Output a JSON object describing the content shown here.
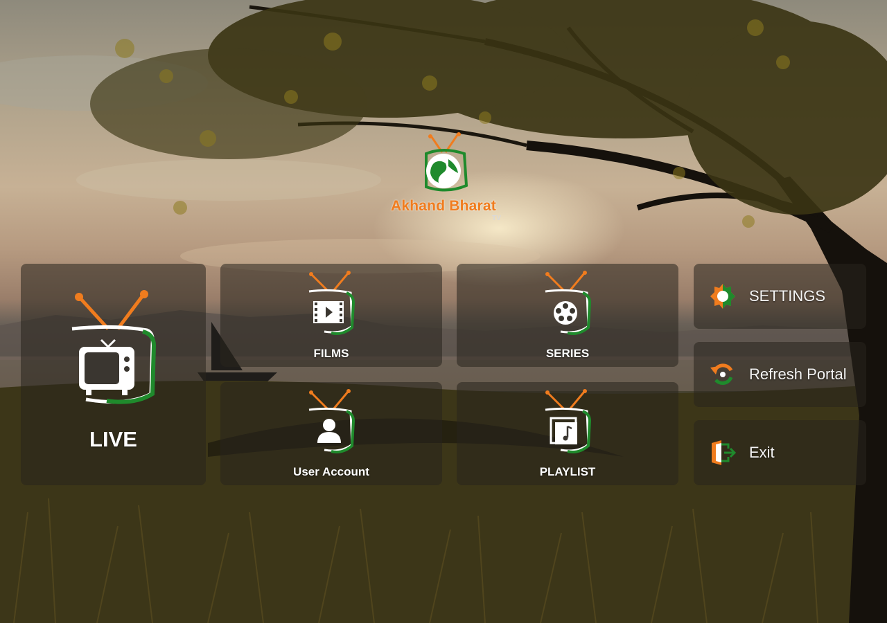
{
  "app": {
    "brand_name": "Akhand Bharat",
    "brand_sub": "TV"
  },
  "tiles": {
    "live": {
      "label": "LIVE",
      "icon": "tv-icon"
    },
    "films": {
      "label": "FILMS",
      "icon": "film-icon"
    },
    "series": {
      "label": "SERIES",
      "icon": "film-reel-icon"
    },
    "user_account": {
      "label": "User Account",
      "icon": "user-icon"
    },
    "playlist": {
      "label": "PLAYLIST",
      "icon": "music-playlist-icon"
    }
  },
  "side_menu": {
    "settings": {
      "label": "SETTINGS",
      "icon": "gear-icon"
    },
    "refresh": {
      "label": "Refresh Portal",
      "icon": "refresh-icon"
    },
    "exit": {
      "label": "Exit",
      "icon": "exit-icon"
    }
  },
  "colors": {
    "accent_orange": "#f07c1e",
    "accent_green": "#1f8a2c",
    "panel": "#28241e"
  }
}
